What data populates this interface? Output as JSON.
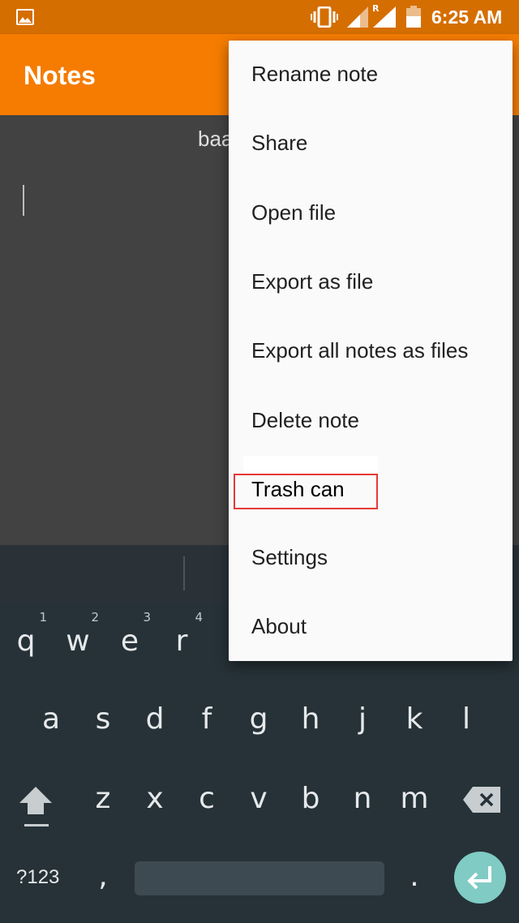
{
  "status_bar": {
    "time": "6:25 AM",
    "roaming": "R",
    "icons": [
      "gallery-icon",
      "vibrate-icon",
      "signal-icon",
      "signal-roaming-icon",
      "battery-icon"
    ]
  },
  "app_bar": {
    "title": "Notes",
    "color": "#f57c00"
  },
  "note": {
    "title": "baa"
  },
  "menu": {
    "items": [
      {
        "label": "Rename note"
      },
      {
        "label": "Share"
      },
      {
        "label": "Open file"
      },
      {
        "label": "Export as file"
      },
      {
        "label": "Export all notes as files"
      },
      {
        "label": "Delete note"
      },
      {
        "label": "Trash can"
      },
      {
        "label": "Settings"
      },
      {
        "label": "About"
      }
    ]
  },
  "keyboard": {
    "row1": [
      {
        "k": "q",
        "h": "1"
      },
      {
        "k": "w",
        "h": "2"
      },
      {
        "k": "e",
        "h": "3"
      },
      {
        "k": "r",
        "h": "4"
      }
    ],
    "row2": [
      "a",
      "s",
      "d",
      "f",
      "g",
      "h",
      "j",
      "k",
      "l"
    ],
    "row3": [
      "z",
      "x",
      "c",
      "v",
      "b",
      "n",
      "m"
    ],
    "symbols_label": "?123",
    "comma": ",",
    "period": ".",
    "accent": "#80cbc4"
  }
}
